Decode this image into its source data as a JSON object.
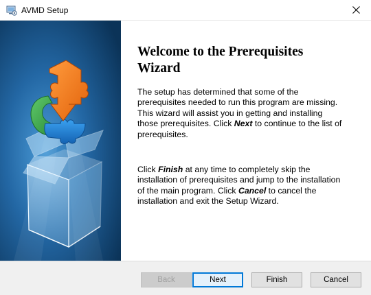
{
  "window": {
    "title": "AVMD Setup",
    "icons": {
      "app": "setup-app-icon",
      "close": "close-icon"
    }
  },
  "banner": {
    "image": "box-with-puzzle-arrow-illustration",
    "colors": {
      "background_dark": "#0d3e66",
      "background_light": "#2f7fbc",
      "orange": "#f07a1a",
      "green": "#3aa648",
      "blue": "#1f7fd1"
    }
  },
  "content": {
    "heading_line1": "Welcome to the Prerequisites",
    "heading_line2": "Wizard",
    "para1": {
      "before": "The setup has determined that some of the prerequisites needed to run this program are missing. This wizard will assist you in getting and installing those prerequisites. Click ",
      "emphasis": "Next",
      "after": " to continue to the list of prerequisites."
    },
    "para2": {
      "part1": "Click ",
      "finish": "Finish",
      "part2": " at any time to completely skip the installation of prerequisites and jump to the installation of the main program. Click ",
      "cancel": "Cancel",
      "part3": " to cancel the installation and exit the Setup Wizard."
    }
  },
  "buttons": {
    "back": "Back",
    "next": "Next",
    "finish": "Finish",
    "cancel": "Cancel"
  }
}
